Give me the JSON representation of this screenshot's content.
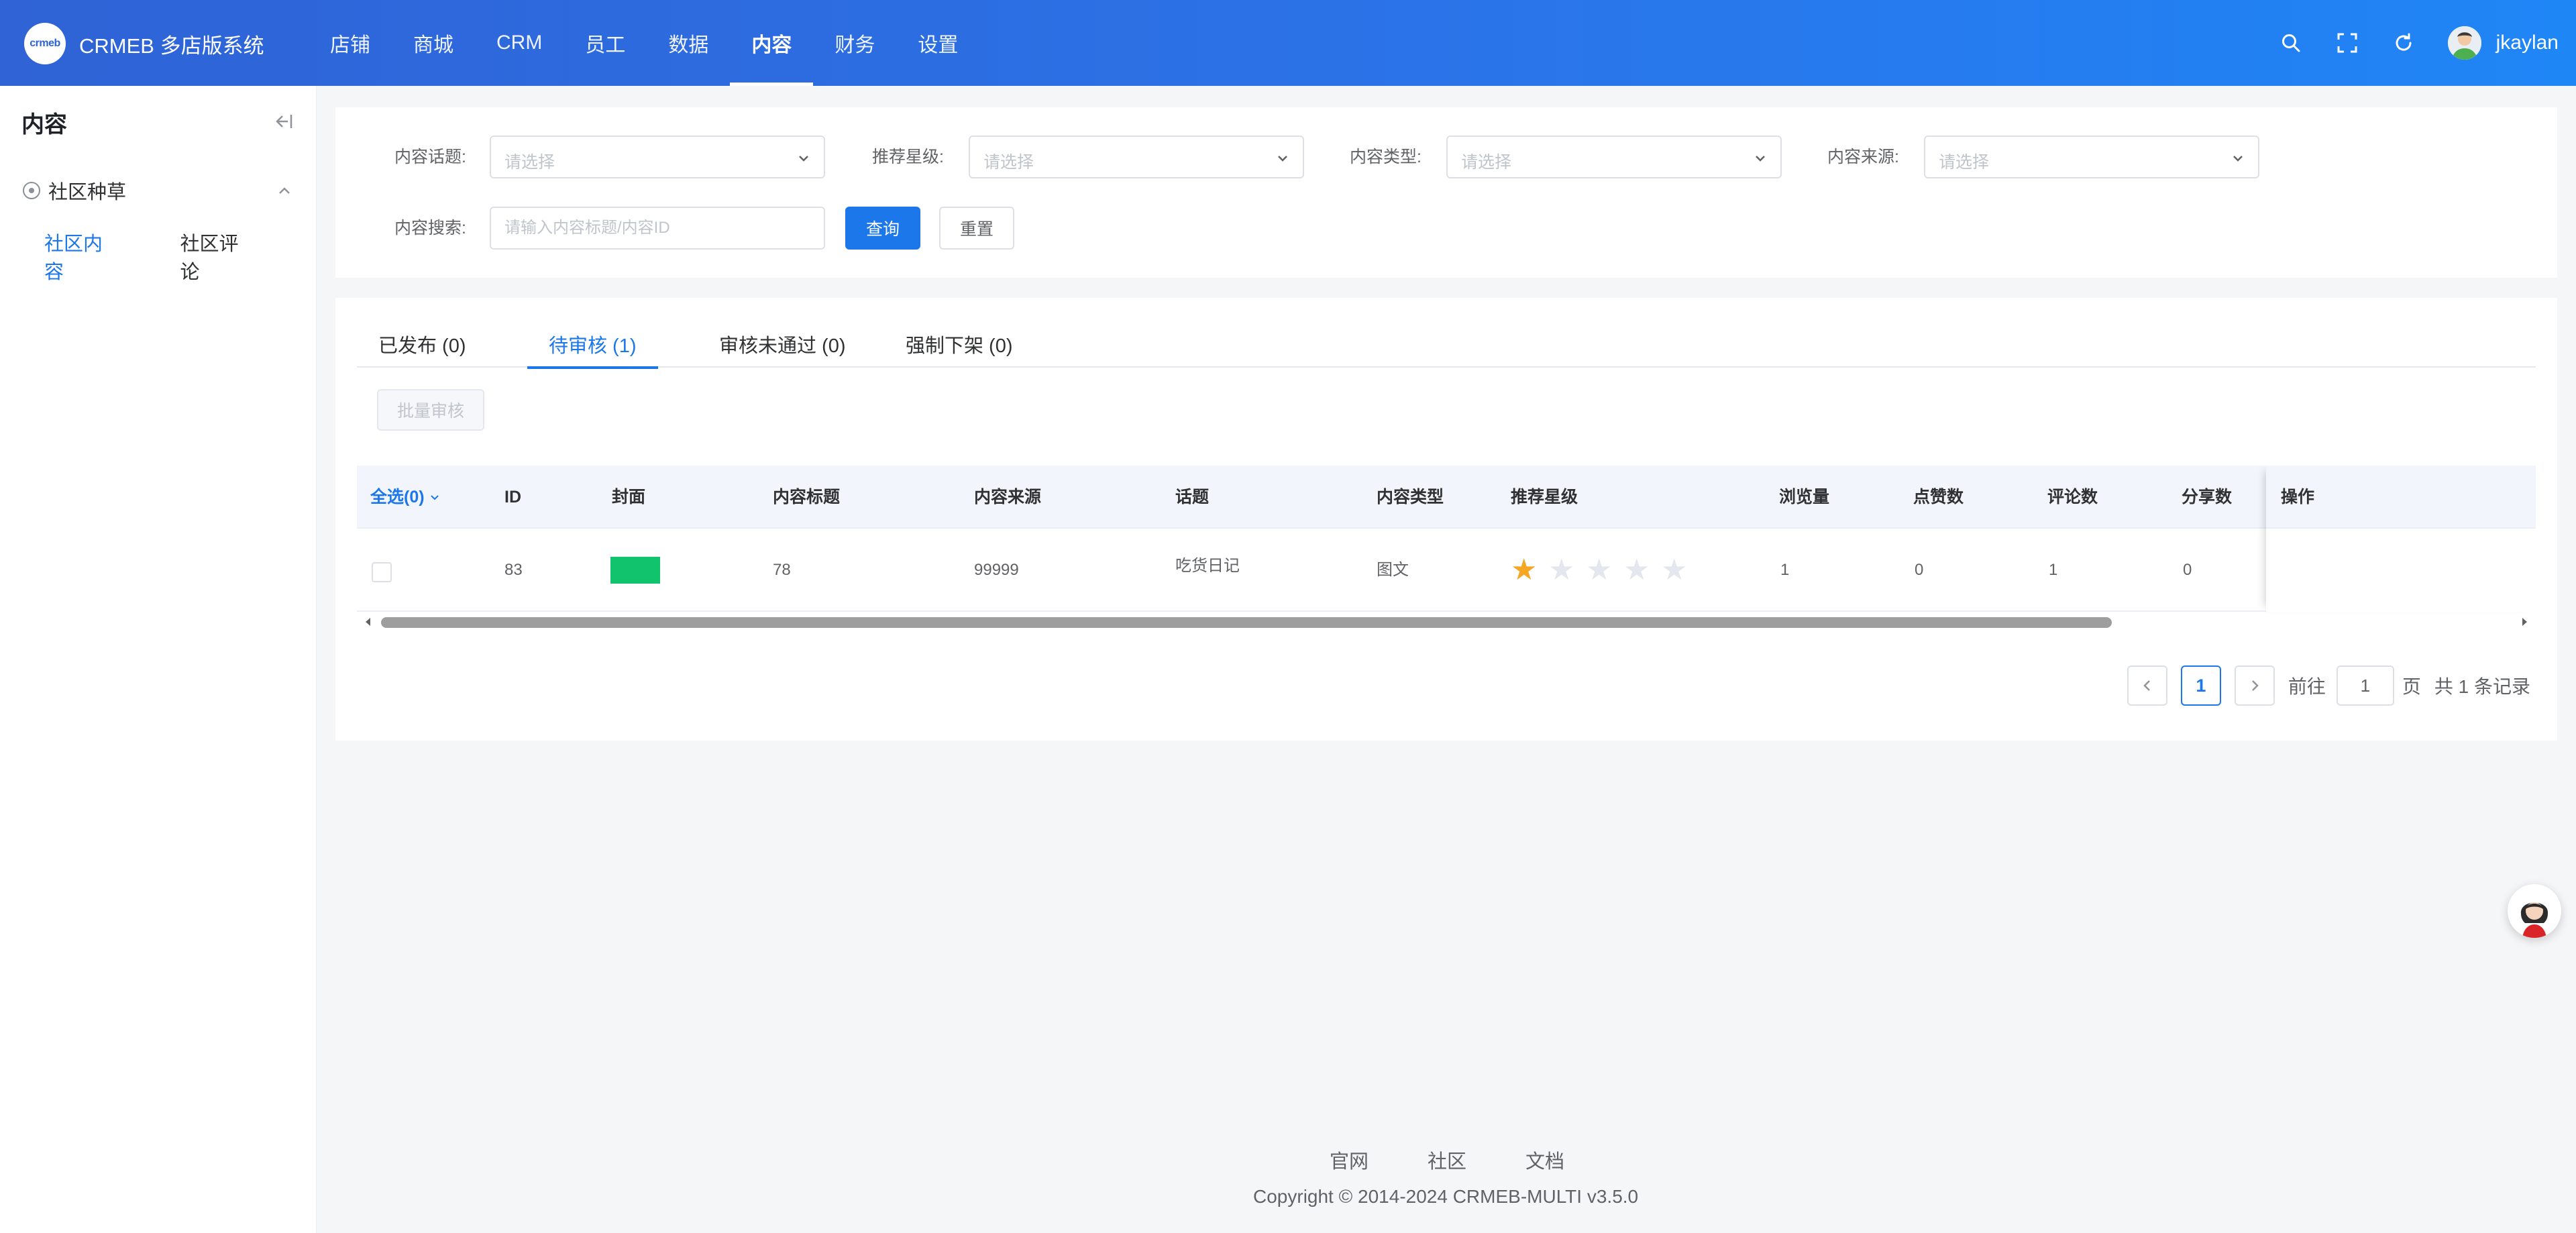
{
  "header": {
    "logo_text": "crmeb",
    "brand": "CRMEB 多店版系统",
    "nav": [
      {
        "label": "店铺"
      },
      {
        "label": "商城"
      },
      {
        "label": "CRM"
      },
      {
        "label": "员工"
      },
      {
        "label": "数据"
      },
      {
        "label": "内容",
        "active": true
      },
      {
        "label": "财务"
      },
      {
        "label": "设置"
      }
    ],
    "user": "jkaylan",
    "colors": {
      "from": "#2f63d6",
      "to": "#1f86f6"
    }
  },
  "sidebar": {
    "title": "内容",
    "group": "社区种草",
    "items": [
      {
        "label": "社区内容",
        "active": true
      },
      {
        "label": "社区评论"
      }
    ]
  },
  "filters": {
    "topic": {
      "label": "内容话题:",
      "placeholder": "请选择"
    },
    "stars": {
      "label": "推荐星级:",
      "placeholder": "请选择"
    },
    "type": {
      "label": "内容类型:",
      "placeholder": "请选择"
    },
    "source": {
      "label": "内容来源:",
      "placeholder": "请选择"
    },
    "search": {
      "label": "内容搜索:",
      "placeholder": "请输入内容标题/内容ID",
      "value": ""
    },
    "query_label": "查询",
    "reset_label": "重置"
  },
  "tabs": [
    {
      "label": "已发布 (0)"
    },
    {
      "label": "待审核 (1)",
      "active": true
    },
    {
      "label": "审核未通过 (0)"
    },
    {
      "label": "强制下架 (0)"
    }
  ],
  "batch_label": "批量审核",
  "table": {
    "columns": {
      "select_all": "全选(0)",
      "id": "ID",
      "cover": "封面",
      "title": "内容标题",
      "source": "内容来源",
      "topic": "话题",
      "type": "内容类型",
      "stars": "推荐星级",
      "views": "浏览量",
      "likes": "点赞数",
      "comments": "评论数",
      "shares": "分享数",
      "ops": "操作"
    },
    "rows": [
      {
        "id": "83",
        "cover_color": "#11c36c",
        "title": "78",
        "source": "99999",
        "topic": "吃货日记",
        "type": "图文",
        "stars": 1,
        "stars_max": 5,
        "views": "1",
        "likes": "0",
        "comments": "1",
        "shares": "0"
      }
    ]
  },
  "pagination": {
    "current": "1",
    "goto_label": "前往",
    "goto_value": "1",
    "page_label": "页",
    "total_label": "共 1 条记录"
  },
  "footer": {
    "links": [
      {
        "label": "官网"
      },
      {
        "label": "社区"
      },
      {
        "label": "文档"
      }
    ],
    "copyright": "Copyright © 2014-2024 CRMEB-MULTI v3.5.0"
  },
  "accent_color": "#1b77ea"
}
